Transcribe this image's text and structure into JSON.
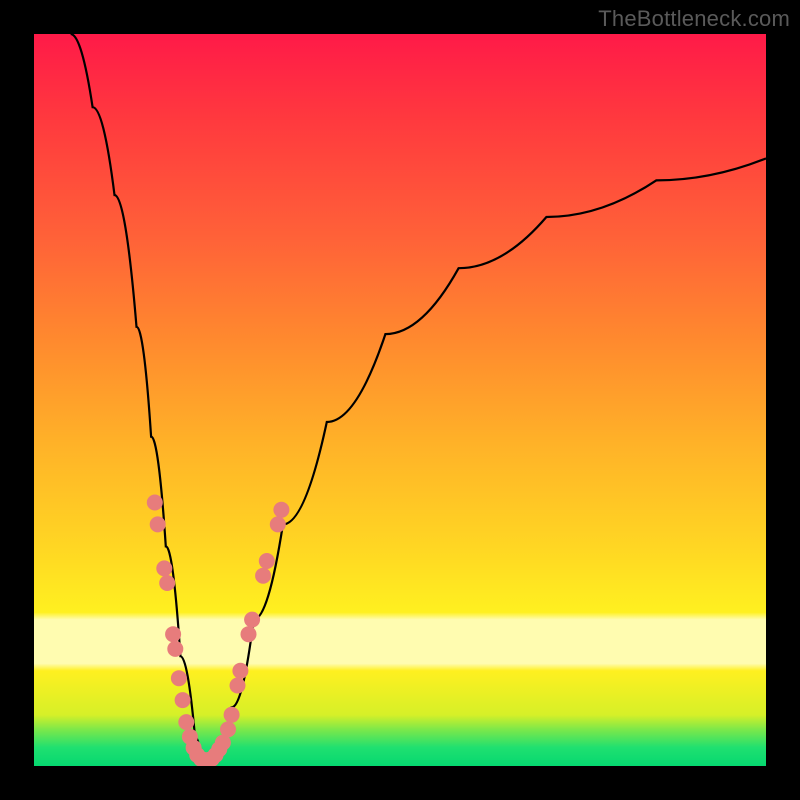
{
  "watermark": "TheBottleneck.com",
  "chart_data": {
    "type": "line",
    "title": "",
    "xlabel": "",
    "ylabel": "",
    "xlim": [
      0,
      100
    ],
    "ylim": [
      0,
      100
    ],
    "grid": false,
    "legend": false,
    "note": "V-shaped bottleneck curve; values estimated from pixel heights (higher value = higher on plot). Minimum near x≈23.",
    "curve": [
      {
        "x": 5,
        "y": 100
      },
      {
        "x": 8,
        "y": 90
      },
      {
        "x": 11,
        "y": 78
      },
      {
        "x": 14,
        "y": 60
      },
      {
        "x": 16,
        "y": 45
      },
      {
        "x": 18,
        "y": 30
      },
      {
        "x": 20,
        "y": 15
      },
      {
        "x": 22,
        "y": 4
      },
      {
        "x": 23,
        "y": 0
      },
      {
        "x": 25,
        "y": 2
      },
      {
        "x": 27,
        "y": 8
      },
      {
        "x": 30,
        "y": 20
      },
      {
        "x": 34,
        "y": 33
      },
      {
        "x": 40,
        "y": 47
      },
      {
        "x": 48,
        "y": 59
      },
      {
        "x": 58,
        "y": 68
      },
      {
        "x": 70,
        "y": 75
      },
      {
        "x": 85,
        "y": 80
      },
      {
        "x": 100,
        "y": 83
      }
    ],
    "markers_left": [
      {
        "x": 16.5,
        "y": 36
      },
      {
        "x": 16.9,
        "y": 33
      },
      {
        "x": 17.8,
        "y": 27
      },
      {
        "x": 18.2,
        "y": 25
      },
      {
        "x": 19.0,
        "y": 18
      },
      {
        "x": 19.3,
        "y": 16
      },
      {
        "x": 19.8,
        "y": 12
      },
      {
        "x": 20.3,
        "y": 9
      },
      {
        "x": 20.8,
        "y": 6
      },
      {
        "x": 21.3,
        "y": 4
      }
    ],
    "markers_bottom": [
      {
        "x": 21.8,
        "y": 2.5
      },
      {
        "x": 22.3,
        "y": 1.5
      },
      {
        "x": 22.8,
        "y": 1.0
      },
      {
        "x": 23.3,
        "y": 0.8
      },
      {
        "x": 23.8,
        "y": 0.8
      },
      {
        "x": 24.3,
        "y": 1.0
      },
      {
        "x": 24.8,
        "y": 1.5
      },
      {
        "x": 25.3,
        "y": 2.3
      },
      {
        "x": 25.8,
        "y": 3.2
      }
    ],
    "markers_right": [
      {
        "x": 26.5,
        "y": 5
      },
      {
        "x": 27.0,
        "y": 7
      },
      {
        "x": 27.8,
        "y": 11
      },
      {
        "x": 28.2,
        "y": 13
      },
      {
        "x": 29.3,
        "y": 18
      },
      {
        "x": 29.8,
        "y": 20
      },
      {
        "x": 31.3,
        "y": 26
      },
      {
        "x": 31.8,
        "y": 28
      },
      {
        "x": 33.3,
        "y": 33
      },
      {
        "x": 33.8,
        "y": 35
      }
    ],
    "marker_radius": 8,
    "colors": {
      "curve": "#000000",
      "marker": "#e77c7c",
      "gradient_top": "#ff1a48",
      "gradient_bottom": "#06d870",
      "watermark": "#5a5a5a"
    }
  }
}
